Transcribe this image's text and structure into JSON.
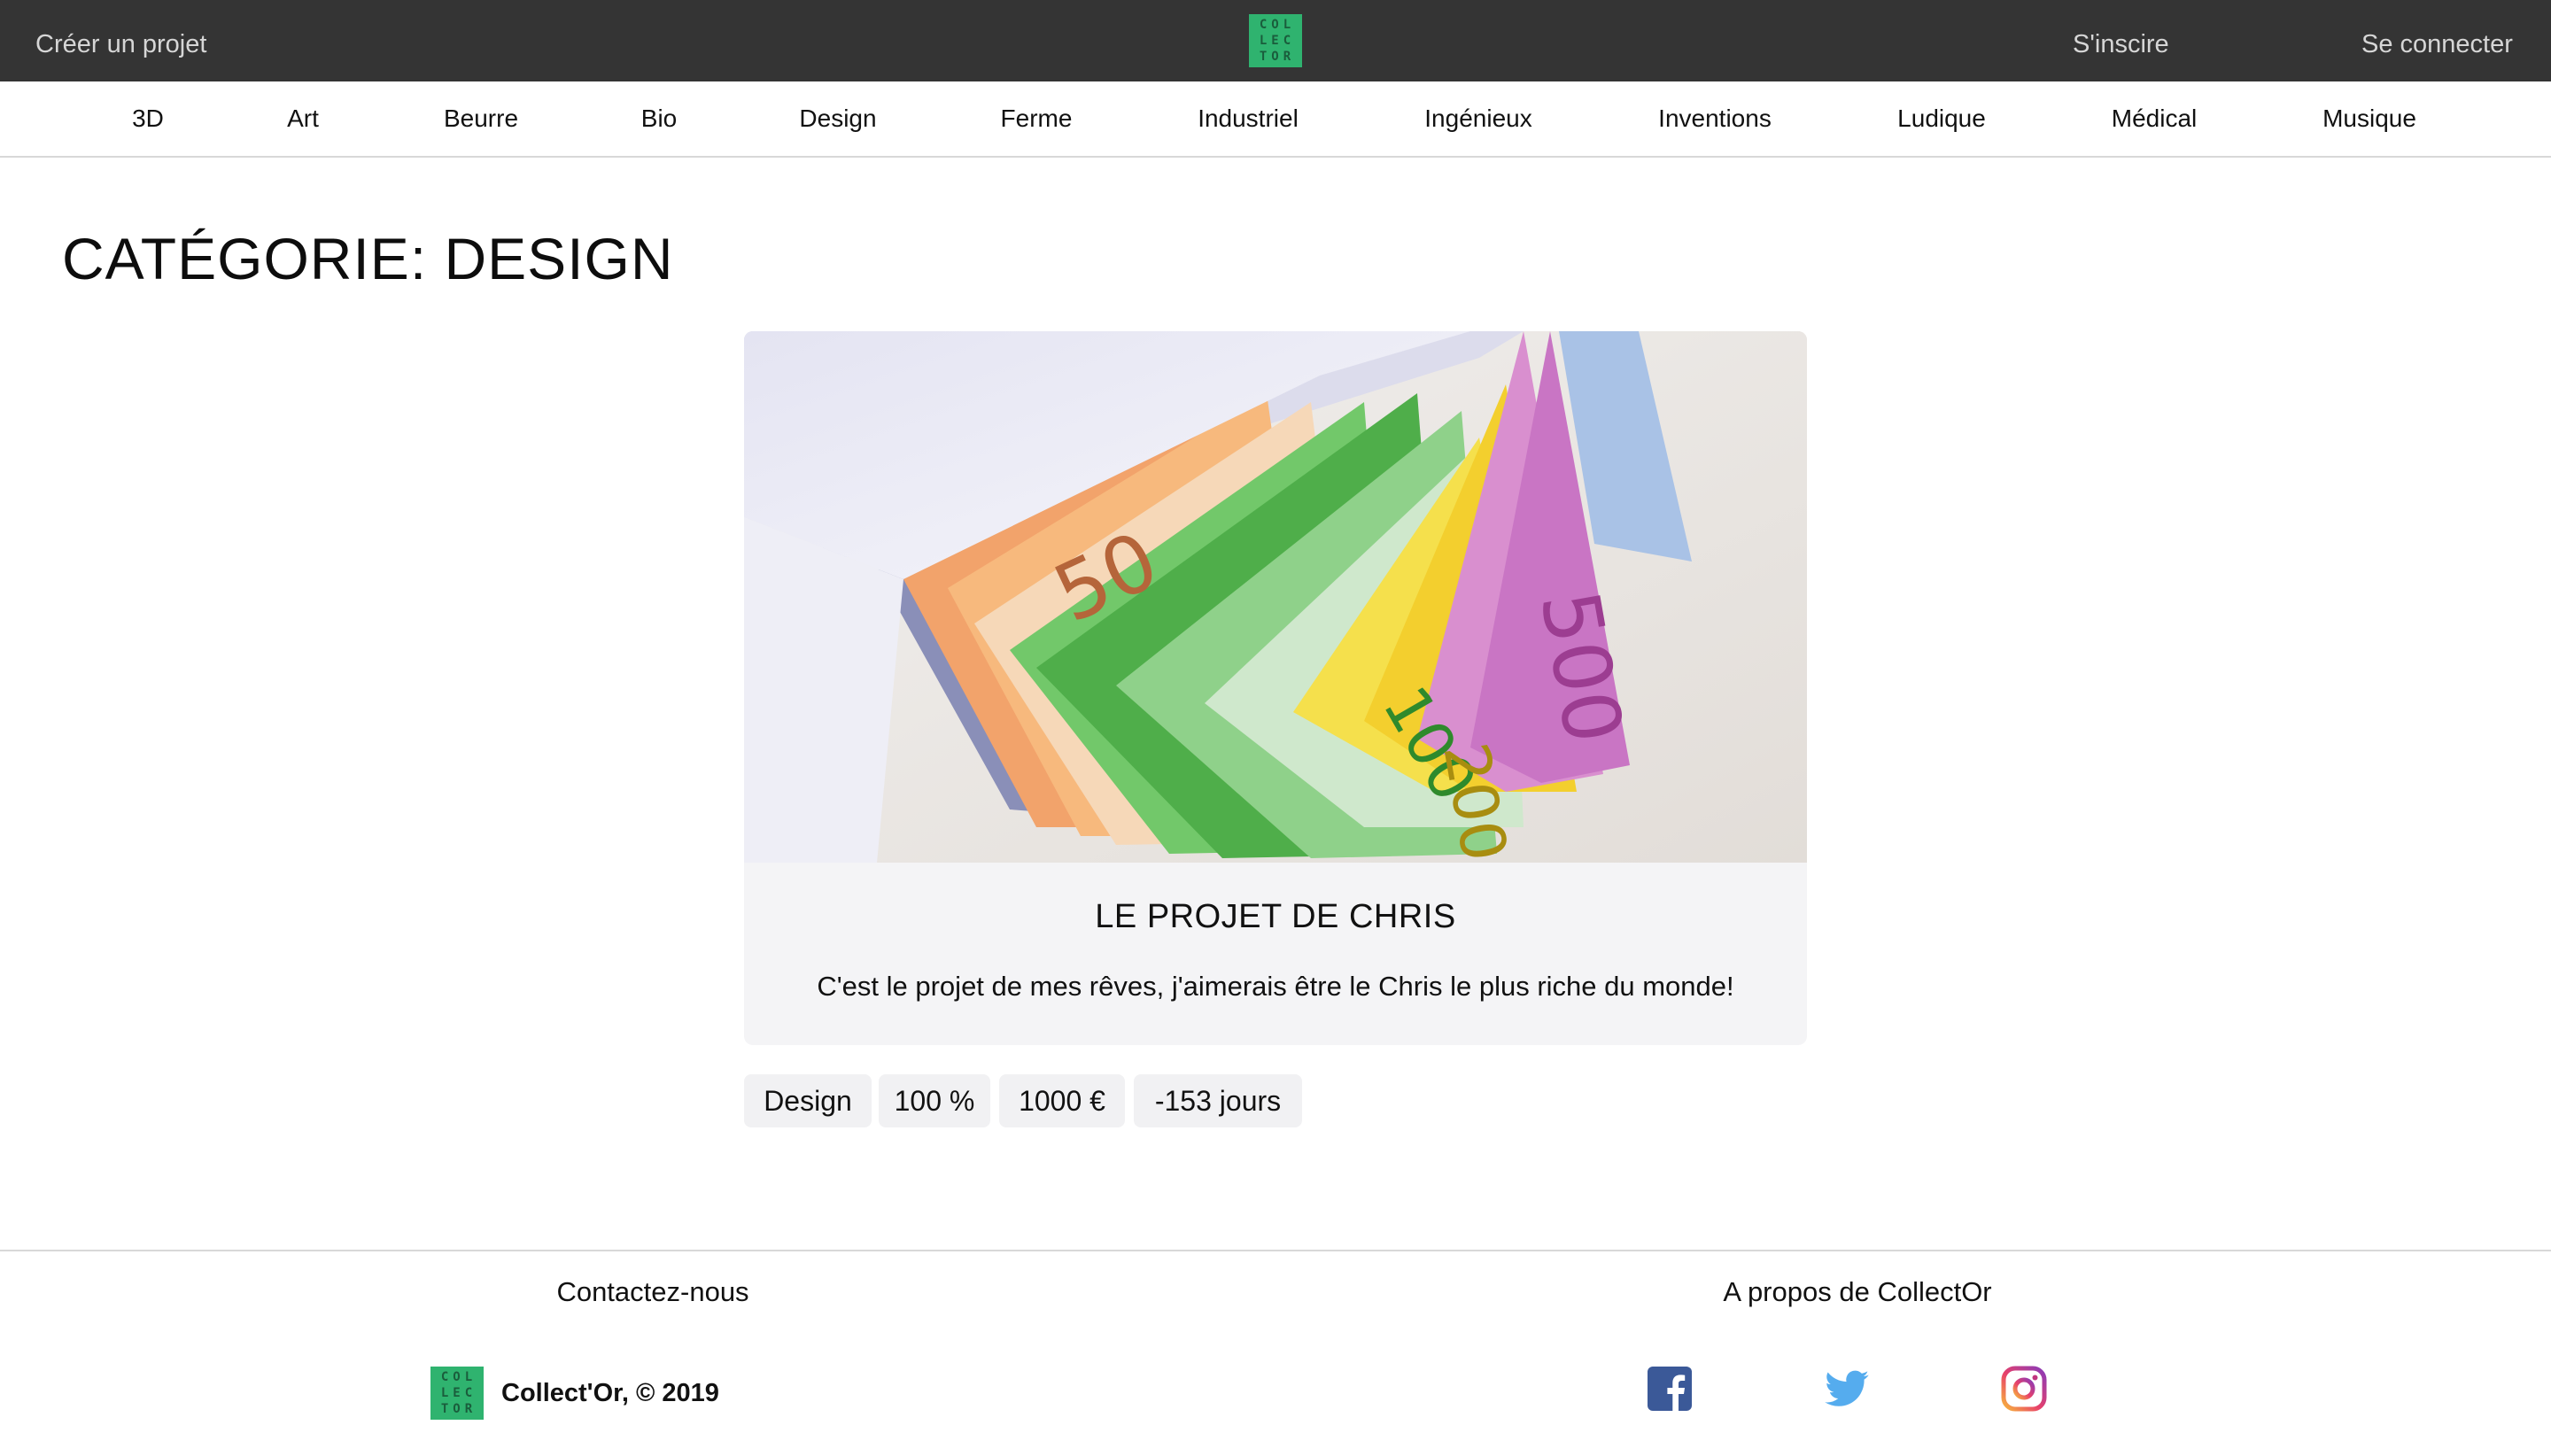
{
  "topbar": {
    "create_project": "Créer un projet",
    "signup": "S'inscire",
    "login": "Se connecter",
    "logo_lines": [
      "COL",
      "LEC",
      "TOR"
    ]
  },
  "categories": [
    "3D",
    "Art",
    "Beurre",
    "Bio",
    "Design",
    "Ferme",
    "Industriel",
    "Ingénieux",
    "Inventions",
    "Ludique",
    "Médical",
    "Musique"
  ],
  "page": {
    "title": "CATÉGORIE: DESIGN"
  },
  "project": {
    "title": "LE PROJET DE CHRIS",
    "description": "C'est le projet de mes rêves, j'aimerais être le Chris le plus riche du monde!",
    "tags": [
      "Design",
      "100 %",
      "1000 €",
      "-153 jours"
    ]
  },
  "footer": {
    "contact": "Contactez-nous",
    "about": "A propos de CollectOr",
    "copyright": "Collect'Or, © 2019",
    "logo_lines": [
      "COL",
      "LEC",
      "TOR"
    ],
    "social": [
      "facebook-icon",
      "twitter-icon",
      "instagram-icon"
    ]
  },
  "colors": {
    "topbar_bg": "#343434",
    "brand_green": "#2fb36f",
    "card_bg": "#f4f4f6",
    "facebook": "#3b5998",
    "twitter": "#55acee"
  }
}
